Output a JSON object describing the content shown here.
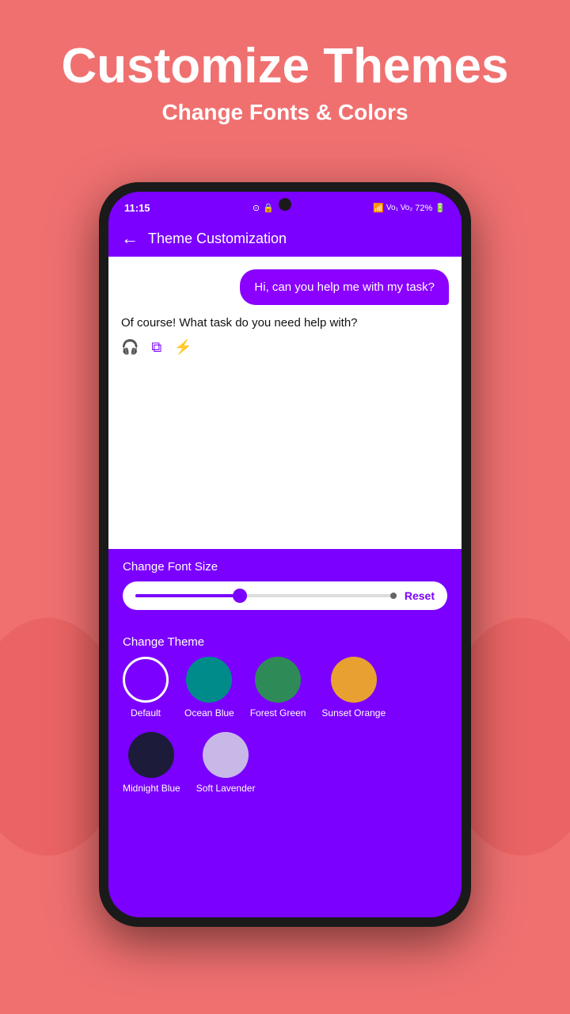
{
  "header": {
    "title": "Customize Themes",
    "subtitle": "Change Fonts & Colors"
  },
  "status_bar": {
    "time": "11:15",
    "battery": "72%"
  },
  "app_bar": {
    "back_label": "←",
    "title": "Theme Customization"
  },
  "chat": {
    "outgoing_message": "Hi, can you help me with my task?",
    "incoming_message": "Of course! What task do you need help with?"
  },
  "font_size": {
    "label": "Change Font Size",
    "reset_label": "Reset"
  },
  "theme": {
    "label": "Change Theme",
    "items": [
      {
        "id": "default",
        "label": "Default",
        "color": "transparent",
        "class": "default"
      },
      {
        "id": "ocean-blue",
        "label": "Ocean Blue",
        "color": "#008B8B",
        "class": "ocean-blue"
      },
      {
        "id": "forest-green",
        "label": "Forest Green",
        "color": "#2E8B57",
        "class": "forest-green"
      },
      {
        "id": "sunset-orange",
        "label": "Sunset Orange",
        "color": "#E8A030",
        "class": "sunset-orange"
      },
      {
        "id": "midnight-blue",
        "label": "Midnight Blue",
        "color": "#1C1C3A",
        "class": "midnight-blue"
      },
      {
        "id": "soft-lavender",
        "label": "Soft Lavender",
        "color": "#C8B8E8",
        "class": "soft-lavender"
      }
    ]
  },
  "colors": {
    "background": "#F07070",
    "phone_bg": "#7B00FF",
    "chat_bubble_outgoing": "#8B00FF",
    "accent": "#7B00FF"
  }
}
